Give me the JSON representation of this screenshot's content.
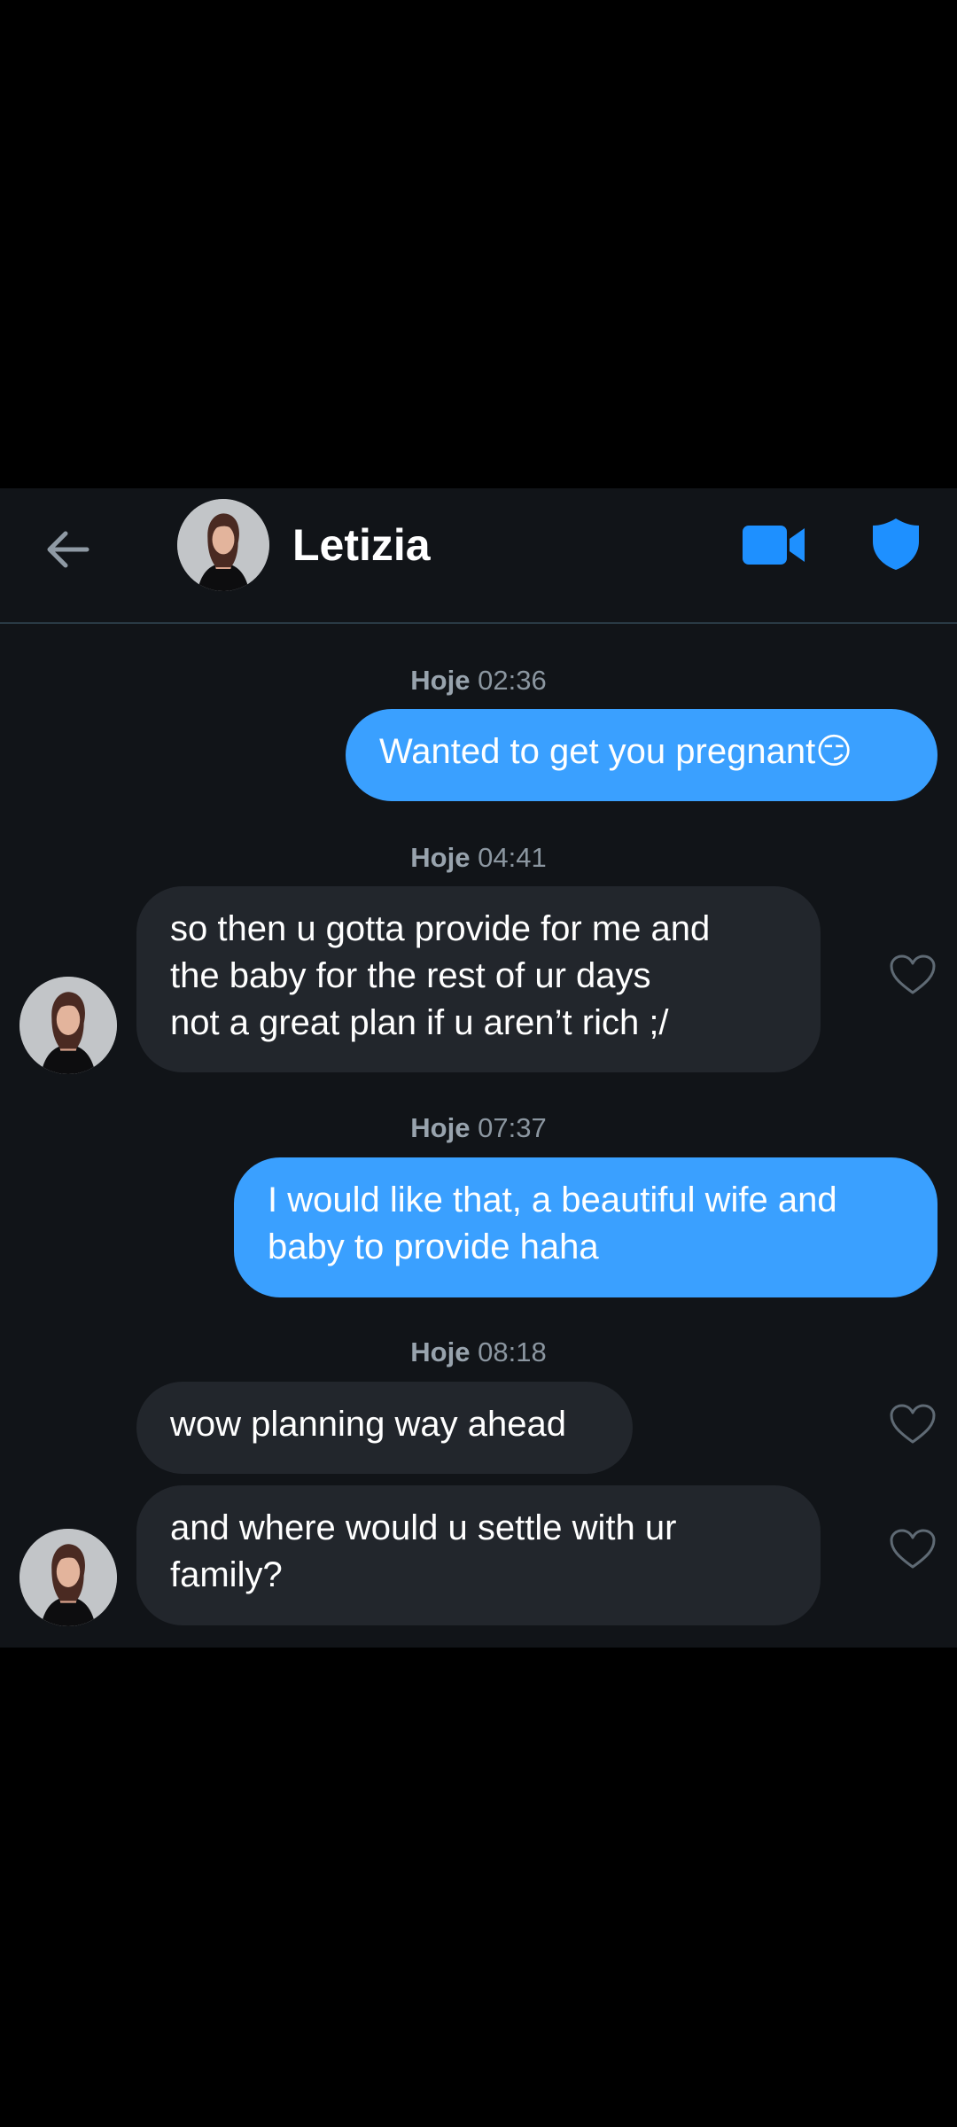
{
  "contact": {
    "name": "Letizia"
  },
  "icons": {
    "back": "arrow-left-icon",
    "video": "video-camera-icon",
    "safety": "shield-icon",
    "like": "heart-outline-icon"
  },
  "colors": {
    "background": "#111418",
    "outgoing_bubble": "#3aa0ff",
    "incoming_bubble": "#22262c",
    "accent": "#1e90ff",
    "timestamp_text": "#8b96a0"
  },
  "timestamps": [
    {
      "day": "Hoje",
      "time": "02:36"
    },
    {
      "day": "Hoje",
      "time": "04:41"
    },
    {
      "day": "Hoje",
      "time": "07:37"
    },
    {
      "day": "Hoje",
      "time": "08:18"
    }
  ],
  "messages": [
    {
      "direction": "outgoing",
      "text": "Wanted to get you pregnant😏"
    },
    {
      "direction": "incoming",
      "text": "so then u gotta provide for me and\nthe baby for the rest of ur days\nnot a great plan if u aren’t rich ;/"
    },
    {
      "direction": "outgoing",
      "text": "I would like that, a beautiful wife and\nbaby to provide haha"
    },
    {
      "direction": "incoming",
      "text": "wow planning way ahead"
    },
    {
      "direction": "incoming",
      "text": "and where would u settle with ur\nfamily?"
    }
  ]
}
